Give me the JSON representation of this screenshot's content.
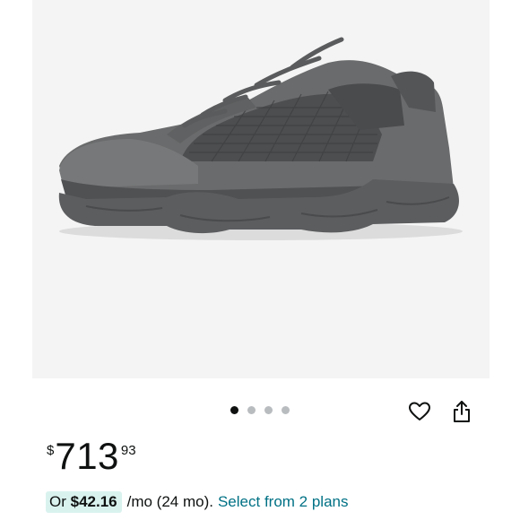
{
  "product": {
    "image_alt": "Grey suede and mesh sneaker with chunky sole",
    "carousel": {
      "count": 4,
      "active": 0
    }
  },
  "actions": {
    "wishlist_icon": "heart-outline-icon",
    "share_icon": "share-icon"
  },
  "pricing": {
    "currency_symbol": "$",
    "whole": "713",
    "fraction": "93",
    "monthly_prefix": "Or",
    "monthly_amount": "$42.16",
    "monthly_term": "/mo (24 mo).",
    "plans_link": "Select from 2 plans"
  },
  "colors": {
    "accent_link": "#007185",
    "pill_bg": "#d9f2ee",
    "dot_active": "#0f1111",
    "dot_inactive": "#b9bcbf"
  }
}
